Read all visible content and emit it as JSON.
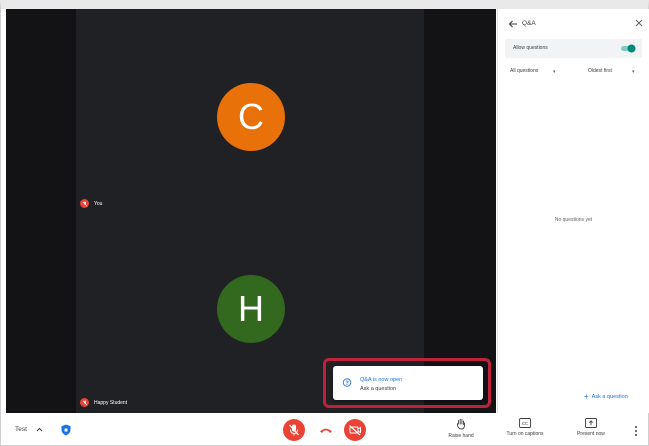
{
  "stage": {
    "participants": [
      {
        "initial": "C",
        "color": "#e8710a"
      },
      {
        "initial": "H",
        "color": "#33691e"
      }
    ],
    "tag_you": "You",
    "tag_student": "Happy Student"
  },
  "toast": {
    "title": "Q&A is now open",
    "subtitle": "Ask a question"
  },
  "panel": {
    "title": "Q&A",
    "allow_label": "Allow questions",
    "allow_enabled": true,
    "filter_label": "All questions",
    "sort_label": "Oldest first",
    "empty_message": "No questions yet",
    "ask_label": "Ask a question"
  },
  "bottombar": {
    "meeting_name": "Test",
    "raise_label": "Raise hand",
    "captions_label": "Turn on captions",
    "present_label": "Present now"
  },
  "colors": {
    "accent": "#1a73e8",
    "danger": "#ea4335",
    "toggle": "#00897b",
    "highlight": "#c0213a"
  }
}
